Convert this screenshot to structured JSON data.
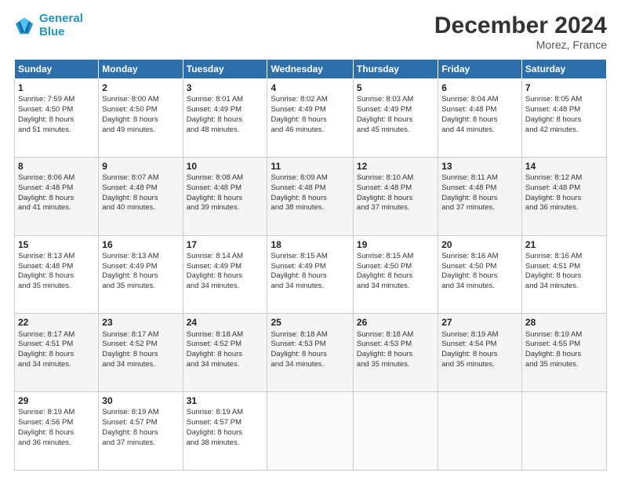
{
  "logo": {
    "line1": "General",
    "line2": "Blue"
  },
  "header": {
    "title": "December 2024",
    "subtitle": "Morez, France"
  },
  "days_of_week": [
    "Sunday",
    "Monday",
    "Tuesday",
    "Wednesday",
    "Thursday",
    "Friday",
    "Saturday"
  ],
  "weeks": [
    [
      {
        "day": "1",
        "info": "Sunrise: 7:59 AM\nSunset: 4:50 PM\nDaylight: 8 hours\nand 51 minutes."
      },
      {
        "day": "2",
        "info": "Sunrise: 8:00 AM\nSunset: 4:50 PM\nDaylight: 8 hours\nand 49 minutes."
      },
      {
        "day": "3",
        "info": "Sunrise: 8:01 AM\nSunset: 4:49 PM\nDaylight: 8 hours\nand 48 minutes."
      },
      {
        "day": "4",
        "info": "Sunrise: 8:02 AM\nSunset: 4:49 PM\nDaylight: 8 hours\nand 46 minutes."
      },
      {
        "day": "5",
        "info": "Sunrise: 8:03 AM\nSunset: 4:49 PM\nDaylight: 8 hours\nand 45 minutes."
      },
      {
        "day": "6",
        "info": "Sunrise: 8:04 AM\nSunset: 4:48 PM\nDaylight: 8 hours\nand 44 minutes."
      },
      {
        "day": "7",
        "info": "Sunrise: 8:05 AM\nSunset: 4:48 PM\nDaylight: 8 hours\nand 42 minutes."
      }
    ],
    [
      {
        "day": "8",
        "info": "Sunrise: 8:06 AM\nSunset: 4:48 PM\nDaylight: 8 hours\nand 41 minutes."
      },
      {
        "day": "9",
        "info": "Sunrise: 8:07 AM\nSunset: 4:48 PM\nDaylight: 8 hours\nand 40 minutes."
      },
      {
        "day": "10",
        "info": "Sunrise: 8:08 AM\nSunset: 4:48 PM\nDaylight: 8 hours\nand 39 minutes."
      },
      {
        "day": "11",
        "info": "Sunrise: 8:09 AM\nSunset: 4:48 PM\nDaylight: 8 hours\nand 38 minutes."
      },
      {
        "day": "12",
        "info": "Sunrise: 8:10 AM\nSunset: 4:48 PM\nDaylight: 8 hours\nand 37 minutes."
      },
      {
        "day": "13",
        "info": "Sunrise: 8:11 AM\nSunset: 4:48 PM\nDaylight: 8 hours\nand 37 minutes."
      },
      {
        "day": "14",
        "info": "Sunrise: 8:12 AM\nSunset: 4:48 PM\nDaylight: 8 hours\nand 36 minutes."
      }
    ],
    [
      {
        "day": "15",
        "info": "Sunrise: 8:13 AM\nSunset: 4:48 PM\nDaylight: 8 hours\nand 35 minutes."
      },
      {
        "day": "16",
        "info": "Sunrise: 8:13 AM\nSunset: 4:49 PM\nDaylight: 8 hours\nand 35 minutes."
      },
      {
        "day": "17",
        "info": "Sunrise: 8:14 AM\nSunset: 4:49 PM\nDaylight: 8 hours\nand 34 minutes."
      },
      {
        "day": "18",
        "info": "Sunrise: 8:15 AM\nSunset: 4:49 PM\nDaylight: 8 hours\nand 34 minutes."
      },
      {
        "day": "19",
        "info": "Sunrise: 8:15 AM\nSunset: 4:50 PM\nDaylight: 8 hours\nand 34 minutes."
      },
      {
        "day": "20",
        "info": "Sunrise: 8:16 AM\nSunset: 4:50 PM\nDaylight: 8 hours\nand 34 minutes."
      },
      {
        "day": "21",
        "info": "Sunrise: 8:16 AM\nSunset: 4:51 PM\nDaylight: 8 hours\nand 34 minutes."
      }
    ],
    [
      {
        "day": "22",
        "info": "Sunrise: 8:17 AM\nSunset: 4:51 PM\nDaylight: 8 hours\nand 34 minutes."
      },
      {
        "day": "23",
        "info": "Sunrise: 8:17 AM\nSunset: 4:52 PM\nDaylight: 8 hours\nand 34 minutes."
      },
      {
        "day": "24",
        "info": "Sunrise: 8:18 AM\nSunset: 4:52 PM\nDaylight: 8 hours\nand 34 minutes."
      },
      {
        "day": "25",
        "info": "Sunrise: 8:18 AM\nSunset: 4:53 PM\nDaylight: 8 hours\nand 34 minutes."
      },
      {
        "day": "26",
        "info": "Sunrise: 8:18 AM\nSunset: 4:53 PM\nDaylight: 8 hours\nand 35 minutes."
      },
      {
        "day": "27",
        "info": "Sunrise: 8:19 AM\nSunset: 4:54 PM\nDaylight: 8 hours\nand 35 minutes."
      },
      {
        "day": "28",
        "info": "Sunrise: 8:19 AM\nSunset: 4:55 PM\nDaylight: 8 hours\nand 35 minutes."
      }
    ],
    [
      {
        "day": "29",
        "info": "Sunrise: 8:19 AM\nSunset: 4:56 PM\nDaylight: 8 hours\nand 36 minutes."
      },
      {
        "day": "30",
        "info": "Sunrise: 8:19 AM\nSunset: 4:57 PM\nDaylight: 8 hours\nand 37 minutes."
      },
      {
        "day": "31",
        "info": "Sunrise: 8:19 AM\nSunset: 4:57 PM\nDaylight: 8 hours\nand 38 minutes."
      },
      null,
      null,
      null,
      null
    ]
  ]
}
